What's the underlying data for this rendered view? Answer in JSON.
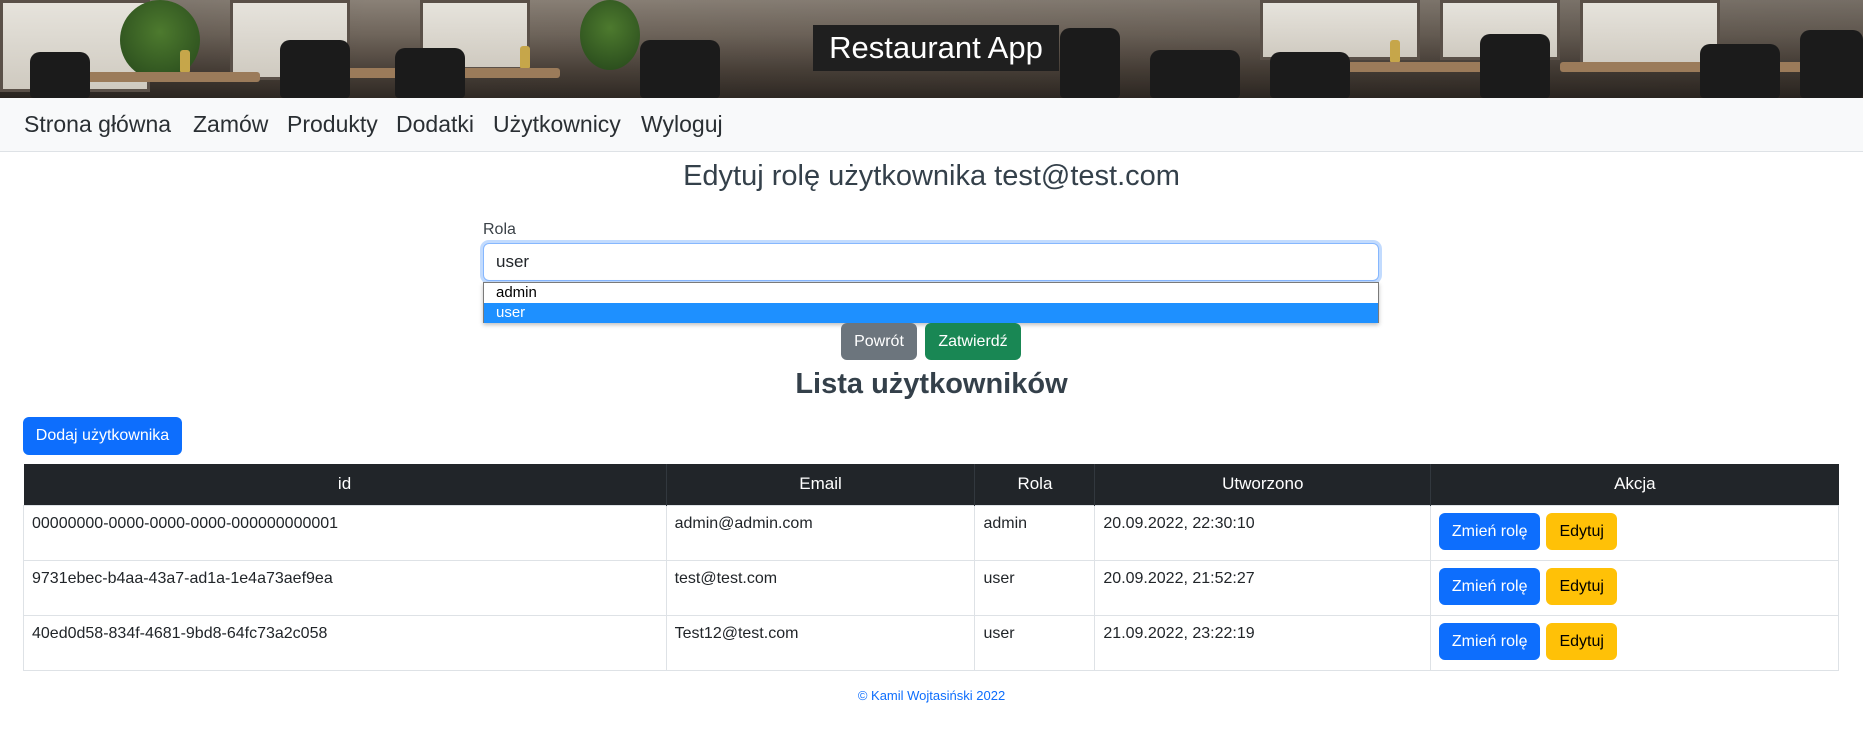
{
  "header": {
    "app_title": "Restaurant App"
  },
  "nav": {
    "items": [
      {
        "label": "Strona główna"
      },
      {
        "label": "Zamów"
      },
      {
        "label": "Produkty"
      },
      {
        "label": "Dodatki"
      },
      {
        "label": "Użytkownicy"
      },
      {
        "label": "Wyloguj"
      }
    ]
  },
  "edit_form": {
    "title": "Edytuj rolę użytkownika test@test.com",
    "role_label": "Rola",
    "role_value": "user",
    "role_options": [
      {
        "label": "admin",
        "selected": false
      },
      {
        "label": "user",
        "selected": true
      }
    ],
    "back_label": "Powrót",
    "submit_label": "Zatwierdź"
  },
  "user_list": {
    "title": "Lista użytkowników",
    "add_label": "Dodaj użytkownika",
    "columns": [
      "id",
      "Email",
      "Rola",
      "Utworzono",
      "Akcja"
    ],
    "rows": [
      {
        "id": "00000000-0000-0000-0000-000000000001",
        "email": "admin@admin.com",
        "role": "admin",
        "created": "20.09.2022, 22:30:10",
        "change_role_label": "Zmień rolę",
        "edit_label": "Edytuj"
      },
      {
        "id": "9731ebec-b4aa-43a7-ad1a-1e4a73aef9ea",
        "email": "test@test.com",
        "role": "user",
        "created": "20.09.2022, 21:52:27",
        "change_role_label": "Zmień rolę",
        "edit_label": "Edytuj"
      },
      {
        "id": "40ed0d58-834f-4681-9bd8-64fc73a2c058",
        "email": "Test12@test.com",
        "role": "user",
        "created": "21.09.2022, 23:22:19",
        "change_role_label": "Zmień rolę",
        "edit_label": "Edytuj"
      }
    ]
  },
  "footer": {
    "text": "© Kamil Wojtasiński 2022"
  },
  "colors": {
    "primary": "#0d6efd",
    "secondary": "#6c757d",
    "success": "#198754",
    "warning": "#ffc107",
    "table_header": "#212529",
    "dropdown_highlight": "#1e90ff"
  }
}
